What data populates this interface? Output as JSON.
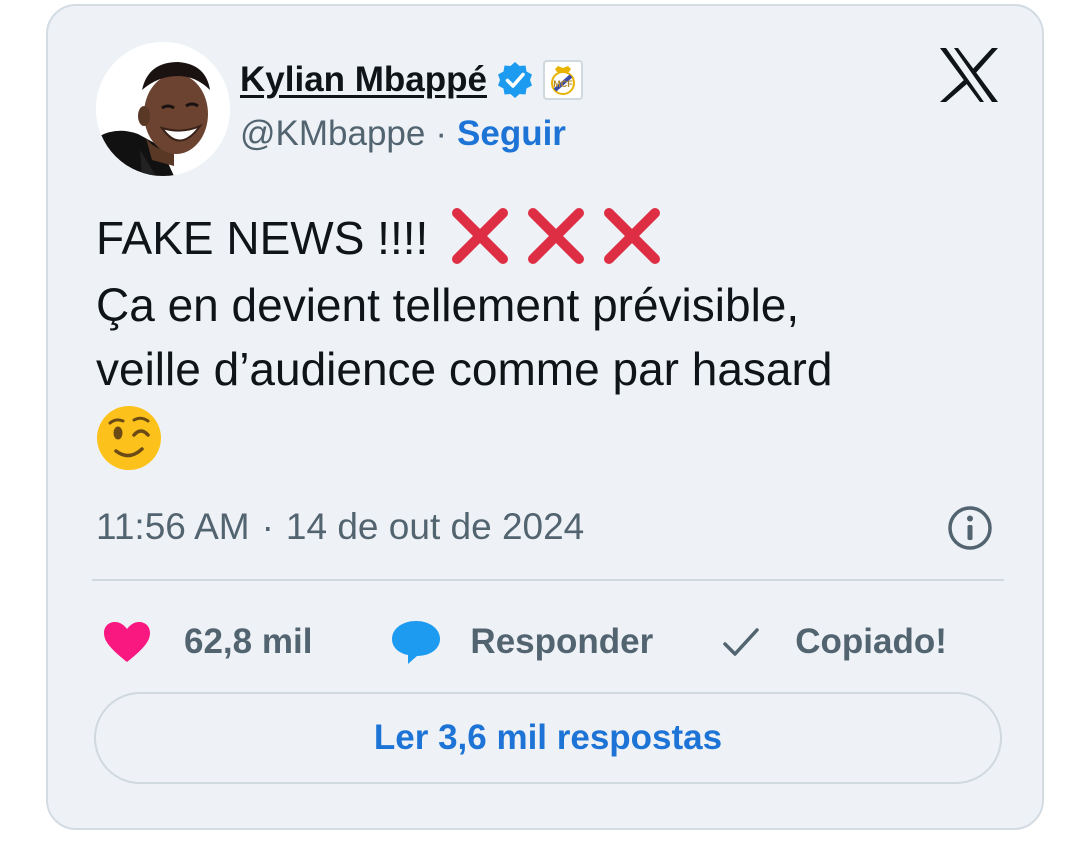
{
  "author": {
    "name": "Kylian Mbappé",
    "handle": "@KMbappe",
    "separator": "·",
    "follow_label": "Seguir",
    "verified": true,
    "affiliate_badge": "real-madrid-crest-icon"
  },
  "tweet": {
    "lines": [
      "FAKE NEWS !!!!",
      "Ça en devient tellement prévisible,",
      "veille d’audience comme par hasard"
    ],
    "emoji_after_first_line": [
      "cross-mark-icon",
      "cross-mark-icon",
      "cross-mark-icon"
    ],
    "trailing_emoji": "winking-face-icon"
  },
  "meta": {
    "time": "11:56 AM",
    "separator": "·",
    "date": "14 de out de 2024"
  },
  "actions": {
    "likes": "62,8 mil",
    "reply_label": "Responder",
    "copy_label": "Copiado!"
  },
  "footer": {
    "read_replies_label": "Ler 3,6 mil respostas"
  },
  "colors": {
    "card_bg": "#eef2f6",
    "link_blue": "#1d74d6",
    "heart_pink": "#f91880",
    "cross_red": "#dd2e44",
    "verified_blue": "#1d9bf0",
    "muted_text": "#536471"
  }
}
